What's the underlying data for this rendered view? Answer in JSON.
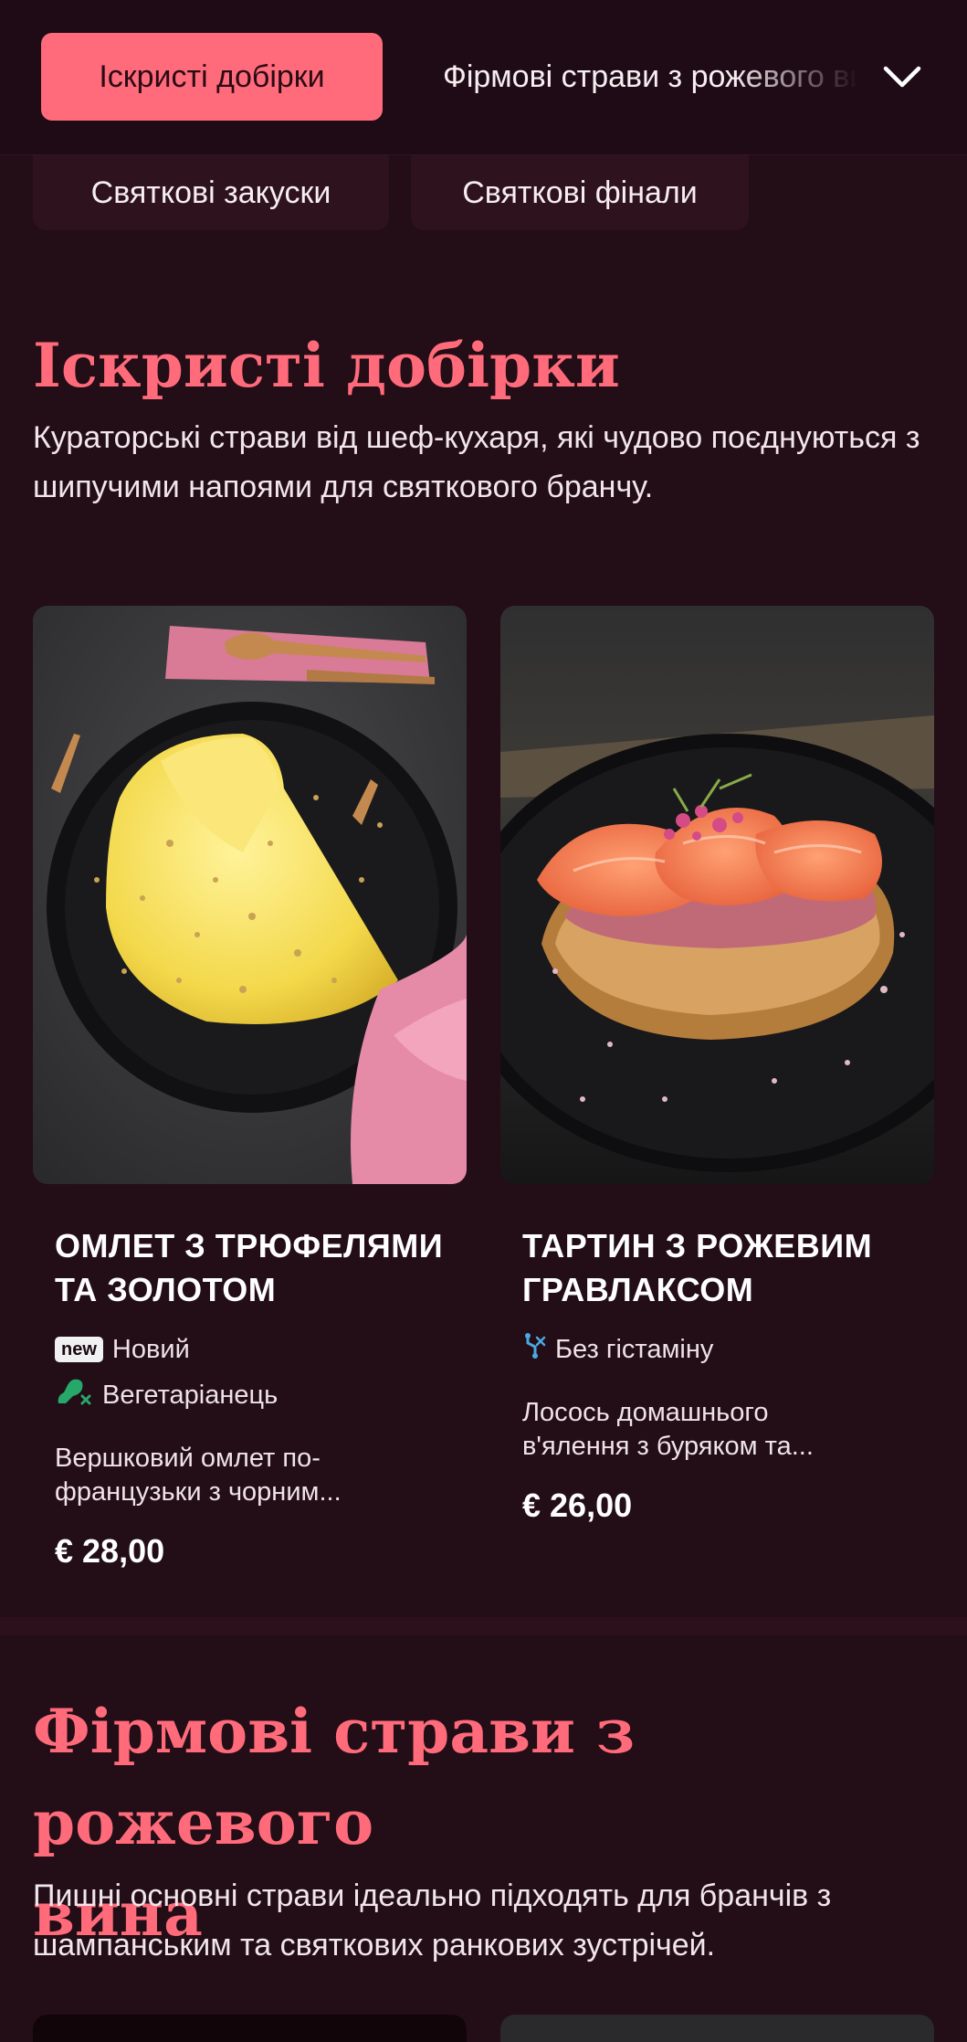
{
  "nav": {
    "active_category": "Іскристі добірки",
    "next_category": "Фірмові страви з рожевого вина",
    "expand_icon": "chevron-down-icon"
  },
  "chips": [
    "Святкові закуски",
    "Святкові фінали"
  ],
  "sections": [
    {
      "title": "Іскристі добірки",
      "description": "Кураторські страви від шеф-кухаря, які чудово поєднуються з шипучими напоями для святкового бранчу."
    },
    {
      "title_line1": "Фірмові страви з рожевого",
      "title_line2": "вина",
      "description": "Пишні основні страви ідеально підходять для бранчів з шампанським та святкових ранкових зустрічей."
    }
  ],
  "items": [
    {
      "title_line1": "ОМЛЕТ З ТРЮФЕЛЯМИ",
      "title_line2": "ТА ЗОЛОТОМ",
      "badge": "new",
      "tag1": "Новий",
      "tag2": "Вегетаріанець",
      "tag2_icon": "vegetarian-icon",
      "desc_line1": "Вершковий омлет по-",
      "desc_line2": "французьки з чорним...",
      "price": "€ 28,00"
    },
    {
      "title_line1": "ТАРТИН З РОЖЕВИМ",
      "title_line2": "ГРАВЛАКСОМ",
      "tag1": "Без гістаміну",
      "tag1_icon": "histamine-free-icon",
      "desc_line1": "Лосось домашнього",
      "desc_line2": "в'ялення з буряком та...",
      "price": "€ 26,00"
    }
  ],
  "colors": {
    "background": "#230d17",
    "accent": "#ff6b7a",
    "chip": "#2e121d"
  }
}
